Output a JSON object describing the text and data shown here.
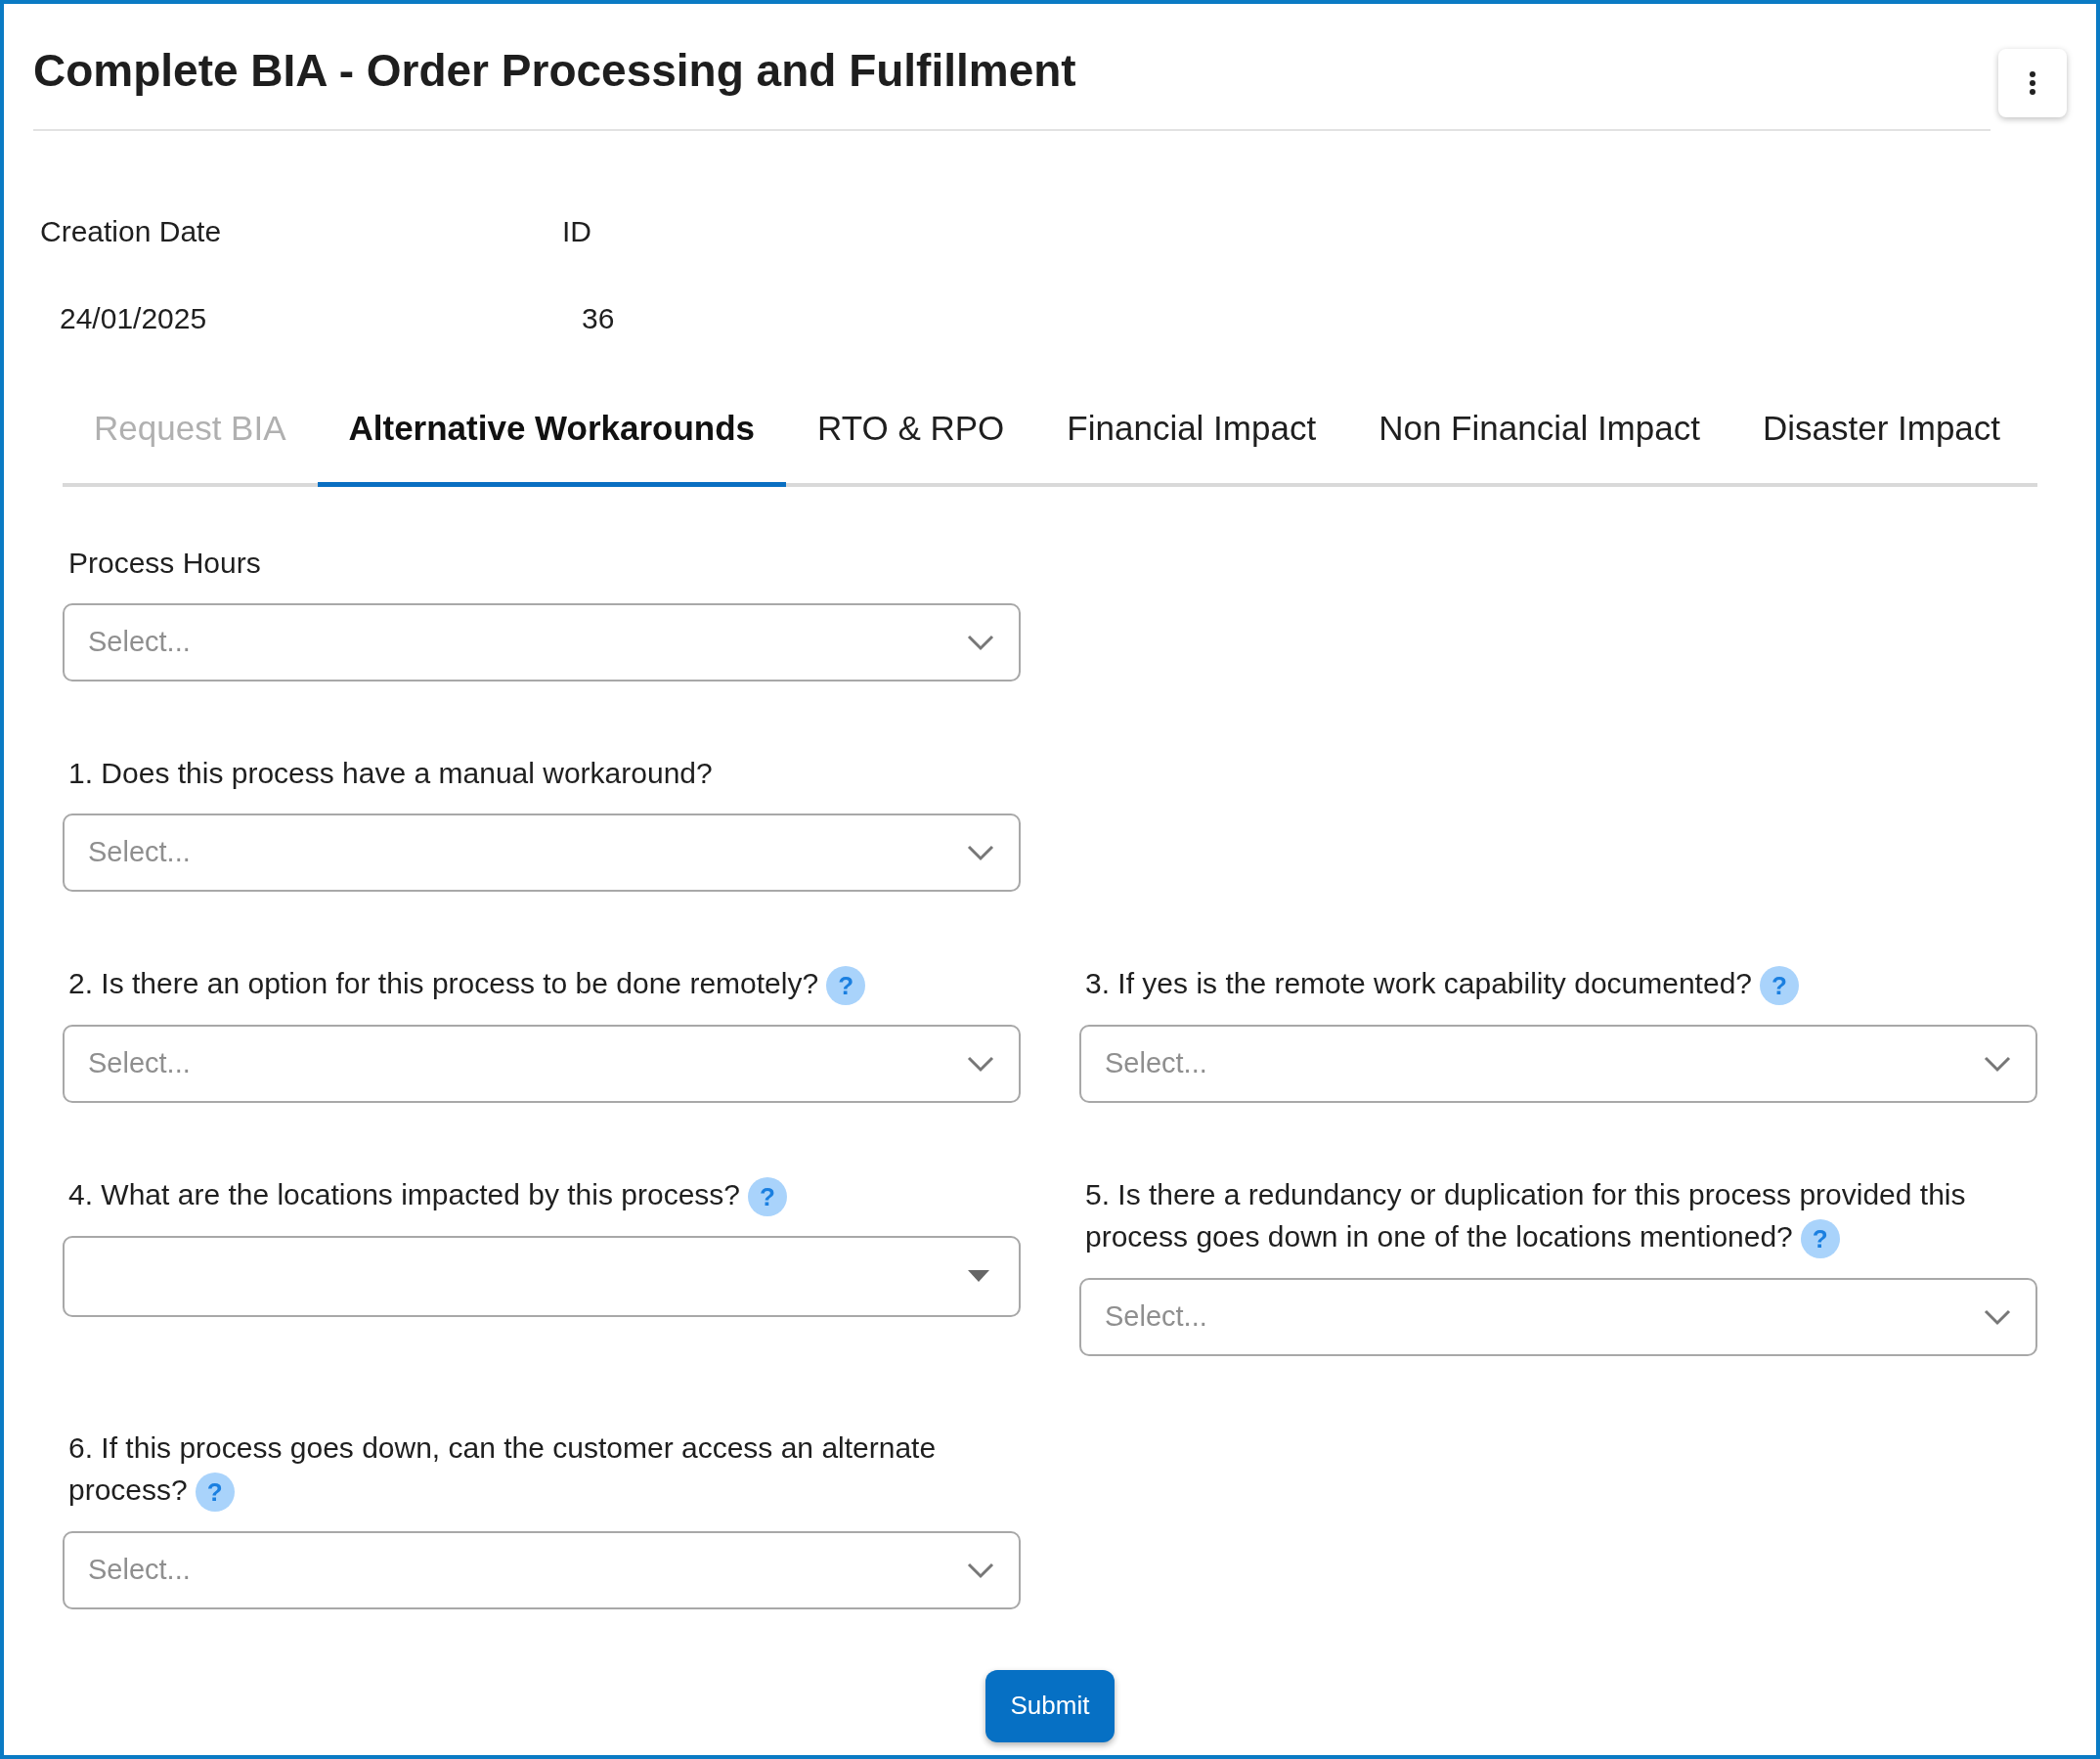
{
  "title": "Complete BIA - Order Processing and Fulfillment",
  "info": [
    {
      "label": "Creation Date",
      "value": "24/01/2025"
    },
    {
      "label": "ID",
      "value": "36"
    }
  ],
  "tabs": [
    {
      "label": "Request BIA",
      "selected": false,
      "disabled": true
    },
    {
      "label": "Alternative Workarounds",
      "selected": true,
      "disabled": false
    },
    {
      "label": "RTO & RPO",
      "selected": false,
      "disabled": false
    },
    {
      "label": "Financial Impact",
      "selected": false,
      "disabled": false
    },
    {
      "label": "Non Financial Impact",
      "selected": false,
      "disabled": false
    },
    {
      "label": "Disaster Impact",
      "selected": false,
      "disabled": false
    }
  ],
  "rows": [
    {
      "fields": [
        {
          "label": "Process Hours",
          "kind": "select",
          "placeholder": "Select..."
        }
      ]
    },
    {
      "fields": [
        {
          "label": "1. Does this process have a manual workaround?",
          "kind": "select",
          "placeholder": "Select..."
        }
      ]
    },
    {
      "fields": [
        {
          "label": "2. Is there an option for this process to be done remotely?",
          "help": "?",
          "kind": "select",
          "placeholder": "Select..."
        },
        {
          "label": "3. If yes is the remote work capability documented?",
          "help": "?",
          "kind": "select",
          "placeholder": "Select..."
        }
      ]
    },
    {
      "fields": [
        {
          "label": "4. What are the locations impacted by this process?",
          "help": "?",
          "kind": "multiselect"
        },
        {
          "label": "5. Is there a redundancy or duplication for this process provided this process goes down in one of the locations mentioned?",
          "help": "?",
          "kind": "select",
          "placeholder": "Select..."
        }
      ]
    },
    {
      "fields": [
        {
          "label": "6. If this process goes down, can the customer access an alternate process?",
          "help": "?",
          "kind": "select",
          "placeholder": "Select..."
        }
      ]
    }
  ],
  "submit": "Submit"
}
